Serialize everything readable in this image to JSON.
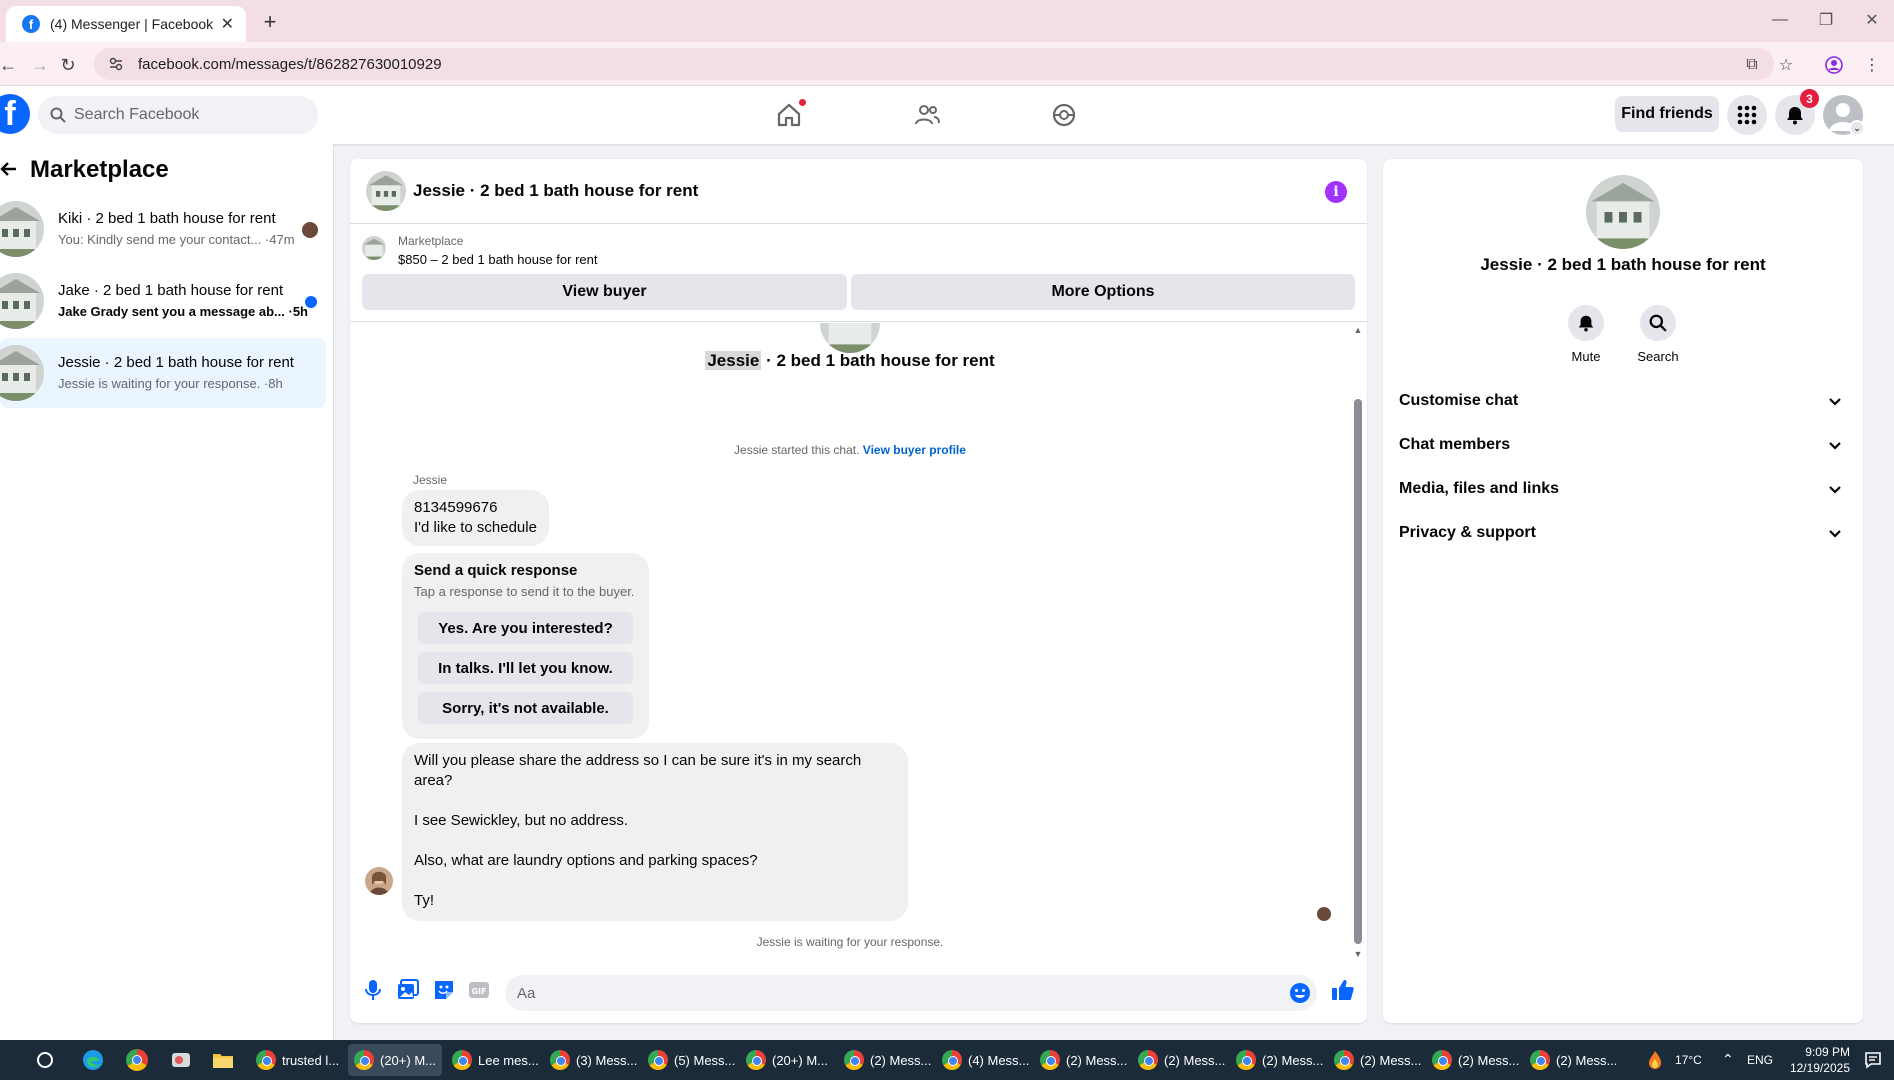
{
  "browser": {
    "tab_title": "(4) Messenger | Facebook",
    "url": "facebook.com/messages/t/862827630010929"
  },
  "header": {
    "search_placeholder": "Search Facebook",
    "find_friends": "Find friends",
    "notification_count": "3"
  },
  "sidebar": {
    "title": "Marketplace",
    "conversations": [
      {
        "name": "Kiki · 2 bed 1 bath house for rent",
        "snippet": "You: Kindly send me your contact... ·47m",
        "unread": false
      },
      {
        "name": "Jake · 2 bed 1 bath house for rent",
        "snippet": "Jake Grady sent you a message ab... ·5h",
        "unread": true
      },
      {
        "name": "Jessie · 2 bed 1 bath house for rent",
        "snippet": "Jessie is waiting for your response. ·8h",
        "unread": false
      }
    ]
  },
  "chat": {
    "title": "Jessie · 2 bed 1 bath house for rent",
    "marketplace_label": "Marketplace",
    "listing": "$850 – 2 bed 1 bath house for rent",
    "view_buyer": "View buyer",
    "more_options": "More Options",
    "big_title_name": "Jessie",
    "big_title_rest": " · 2 bed 1 bath house for rent",
    "started_text": "Jessie started this chat. ",
    "view_buyer_profile": "View buyer profile",
    "sender": "Jessie",
    "msg1_line1": "8134599676",
    "msg1_line2": "I'd like to schedule",
    "quick_title": "Send a quick response",
    "quick_sub": "Tap a response to send it to the buyer.",
    "quick_options": [
      "Yes. Are you interested?",
      "In talks. I'll let you know.",
      "Sorry, it's not available."
    ],
    "msg2_lines": [
      "Will you please share the address so I can be sure it's in my search area?",
      "I see Sewickley, but no address.",
      "Also, what are laundry options and parking spaces?",
      "Ty!"
    ],
    "waiting": "Jessie is waiting for your response.",
    "composer_placeholder": "Aa"
  },
  "right_panel": {
    "name": "Jessie · 2 bed 1 bath house for rent",
    "mute": "Mute",
    "search": "Search",
    "sections": [
      "Customise chat",
      "Chat members",
      "Media, files and links",
      "Privacy & support"
    ]
  },
  "taskbar": {
    "items": [
      "trusted l...",
      "(20+) M...",
      "Lee mes...",
      "(3) Mess...",
      "(5) Mess...",
      "(20+) M...",
      "(2) Mess...",
      "(4) Mess...",
      "(2) Mess...",
      "(2) Mess...",
      "(2) Mess...",
      "(2) Mess...",
      "(2) Mess...",
      "(2) Mess..."
    ],
    "temperature": "17°C",
    "language": "ENG",
    "time": "9:09 PM",
    "date": "12/19/2025"
  },
  "colors": {
    "facebook_blue": "#0866ff",
    "active_convo": "#ebf5ff",
    "info_purple": "#a033ff",
    "badge_red": "#e41e3f"
  }
}
